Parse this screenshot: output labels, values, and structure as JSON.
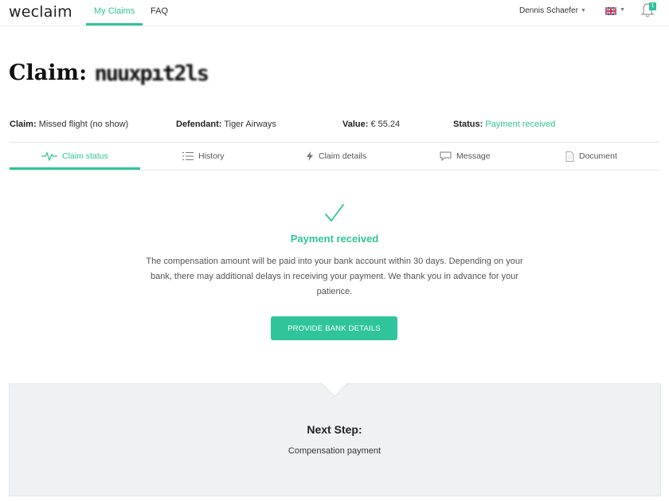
{
  "app": {
    "logo": "weclaim"
  },
  "nav": {
    "links": [
      {
        "label": "My Claims",
        "active": true
      },
      {
        "label": "FAQ",
        "active": false
      }
    ],
    "user_name": "Dennis Schaefer",
    "notification_count": "1",
    "language_flag": "uk-flag-icon"
  },
  "claim": {
    "title_prefix": "Claim:",
    "id_obscured": "nuuxpıt2ls",
    "details": [
      {
        "label": "Claim:",
        "value": "Missed flight (no show)"
      },
      {
        "label": "Defendant:",
        "value": "Tiger Airways"
      },
      {
        "label": "Value:",
        "value": "€ 55.24"
      },
      {
        "label": "Status:",
        "value": "Payment received"
      }
    ]
  },
  "tabs": [
    {
      "label": "Claim status",
      "icon": "pulse-icon",
      "active": true
    },
    {
      "label": "History",
      "icon": "list-icon",
      "active": false
    },
    {
      "label": "Claim details",
      "icon": "bolt-icon",
      "active": false
    },
    {
      "label": "Message",
      "icon": "chat-icon",
      "active": false
    },
    {
      "label": "Document",
      "icon": "document-icon",
      "active": false
    }
  ],
  "status": {
    "icon": "checkmark-icon",
    "title": "Payment received",
    "text": "The compensation amount will be paid into your bank account within 30 days. Depending on your bank, there may additional delays in receiving your payment. We thank you in advance for your patience.",
    "button_label": "PROVIDE BANK DETAILS"
  },
  "next_step": {
    "title": "Next Step:",
    "text": "Compensation payment"
  },
  "colors": {
    "accent": "#2fc49a",
    "panel_bg": "#f0f1f2"
  }
}
